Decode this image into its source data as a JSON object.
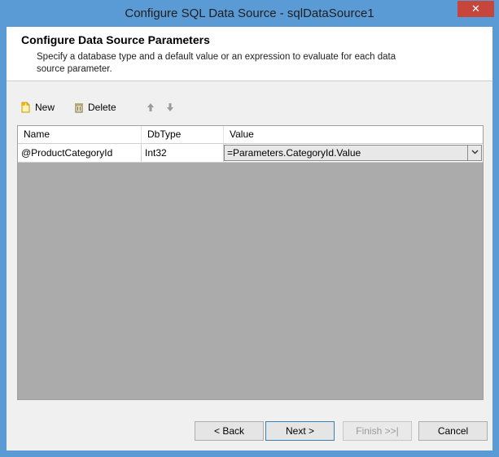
{
  "window": {
    "title": "Configure SQL Data Source - sqlDataSource1",
    "close_label": "✕"
  },
  "header": {
    "title": "Configure Data Source Parameters",
    "description": "Specify a database type and a default value or an expression to evaluate for each data source parameter."
  },
  "toolbar": {
    "new_label": "New",
    "delete_label": "Delete",
    "new_icon": "new-document-icon",
    "delete_icon": "trash-icon",
    "move_up_icon": "arrow-up-icon",
    "move_down_icon": "arrow-down-icon"
  },
  "grid": {
    "columns": [
      "Name",
      "DbType",
      "Value"
    ],
    "rows": [
      {
        "name": "@ProductCategoryId",
        "dbtype": "Int32",
        "value": "=Parameters.CategoryId.Value"
      }
    ]
  },
  "buttons": {
    "back": "< Back",
    "next": "Next >",
    "finish": "Finish >>|",
    "cancel": "Cancel"
  },
  "colors": {
    "title_bar": "#5b9bd5",
    "close_button": "#c7463b",
    "grid_background": "#ababab"
  }
}
